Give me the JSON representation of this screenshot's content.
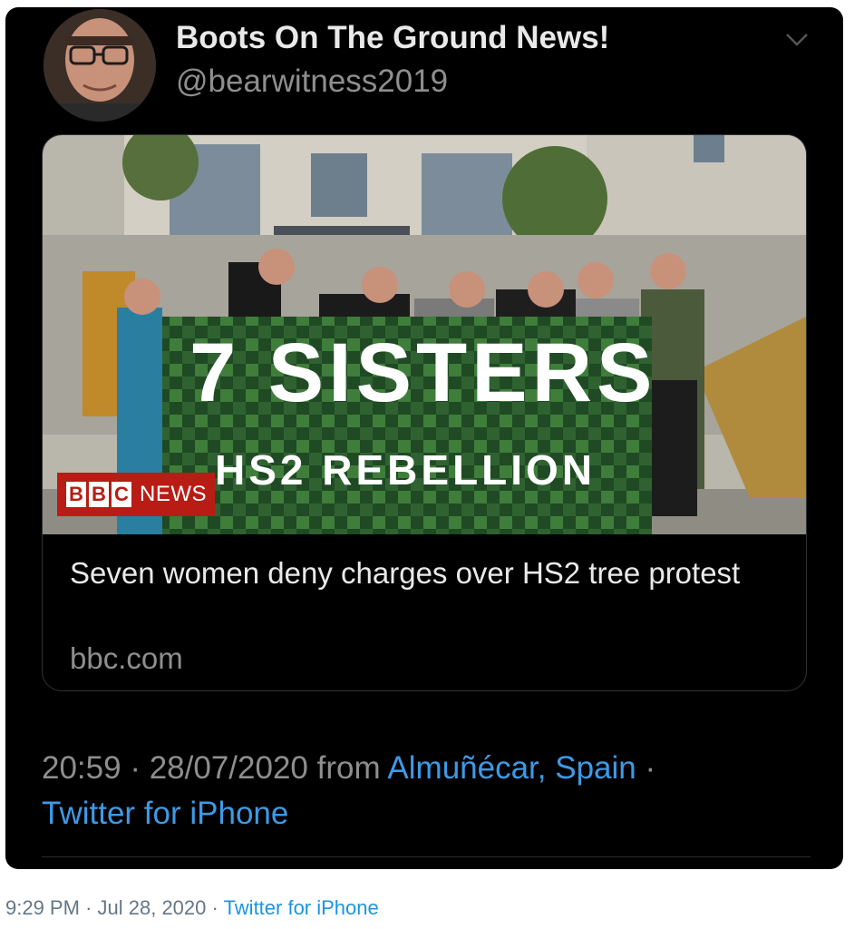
{
  "tweet": {
    "display_name": "Boots On The Ground News!",
    "handle": "@bearwitness2019",
    "link_card": {
      "title": "Seven women deny charges over HS2 tree protest",
      "domain": "bbc.com",
      "image": {
        "banner_main": "7 SISTERS",
        "banner_sub": "HS2 REBELLION",
        "logo_letters": [
          "B",
          "B",
          "C"
        ],
        "logo_word": "NEWS"
      }
    },
    "time": "20:59",
    "date": "28/07/2020",
    "from_label": "from",
    "location": "Almuñécar, Spain",
    "source": "Twitter for iPhone",
    "separator": "·"
  },
  "footer": {
    "time": "9:29 PM",
    "date": "Jul 28, 2020",
    "separator": "·",
    "source": "Twitter for iPhone"
  },
  "colors": {
    "card_bg": "#000000",
    "link_blue": "#3d9ae6",
    "muted_text": "#8e8e8e",
    "footer_link": "#1b95e0",
    "banner_green": "#1f4a24",
    "bbc_red": "#b81c15"
  }
}
